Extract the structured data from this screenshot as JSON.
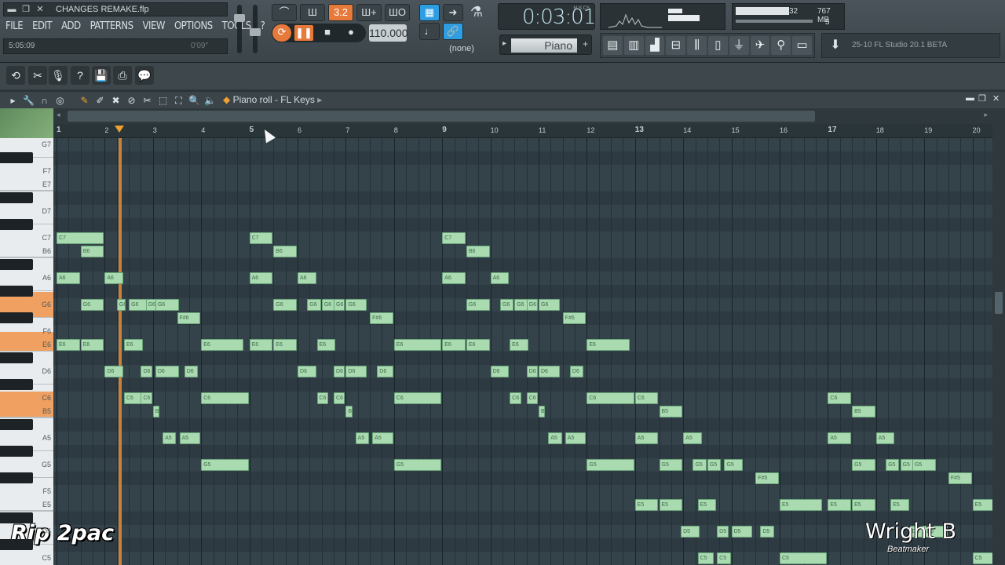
{
  "app": {
    "file_title": "CHANGES REMAKE.flp",
    "menu": [
      "FILE",
      "EDIT",
      "ADD",
      "PATTERNS",
      "VIEW",
      "OPTIONS",
      "TOOLS",
      "?"
    ],
    "hint_time": "5:05:09",
    "hint_right": "0'09\""
  },
  "transport": {
    "time": "0:03:01",
    "time_label": "M:S:CS",
    "tempo": "110.000",
    "pattern": "(none)",
    "beat_label": "3.2",
    "cpu": "32",
    "memory": "767 MB",
    "voices": "5"
  },
  "channel": {
    "name": "Piano"
  },
  "news": {
    "text": "25-10  FL Studio 20.1 BETA"
  },
  "piano_roll": {
    "title": "Piano roll - FL Keys",
    "bars": [
      "1",
      "2",
      "3",
      "4",
      "5",
      "6",
      "7",
      "8",
      "9",
      "10",
      "11",
      "12",
      "13",
      "14",
      "15",
      "16",
      "17",
      "18",
      "19",
      "20"
    ],
    "key_labels": [
      "G7",
      "F7",
      "E7",
      "D7",
      "C7",
      "B6",
      "A6",
      "G6",
      "F6",
      "E6",
      "D6",
      "C6",
      "B5",
      "A5",
      "G5",
      "F5",
      "E5",
      "D5",
      "C5"
    ],
    "notes": [
      {
        "p": "C7",
        "b": 0,
        "w": 1
      },
      {
        "p": "B6",
        "b": 0.5,
        "w": 0.5
      },
      {
        "p": "A6",
        "b": 0,
        "w": 0.5
      },
      {
        "p": "A6",
        "b": 1,
        "w": 0.4
      },
      {
        "p": "G6",
        "b": 0.5,
        "w": 0.5
      },
      {
        "p": "G6",
        "b": 1.25,
        "w": 0.2
      },
      {
        "p": "G6",
        "b": 1.5,
        "w": 0.4
      },
      {
        "p": "G6",
        "b": 1.85,
        "w": 0.25
      },
      {
        "p": "G6",
        "b": 2.05,
        "w": 0.5
      },
      {
        "p": "F#6",
        "b": 2.5,
        "w": 0.5
      },
      {
        "p": "E6",
        "b": 0,
        "w": 0.5
      },
      {
        "p": "E6",
        "b": 0.5,
        "w": 0.5
      },
      {
        "p": "E6",
        "b": 1.4,
        "w": 0.4
      },
      {
        "p": "E6",
        "b": 3,
        "w": 0.9
      },
      {
        "p": "D6",
        "b": 1,
        "w": 0.4
      },
      {
        "p": "D6",
        "b": 1.75,
        "w": 0.25
      },
      {
        "p": "D6",
        "b": 2.05,
        "w": 0.5
      },
      {
        "p": "D6",
        "b": 2.65,
        "w": 0.3
      },
      {
        "p": "C6",
        "b": 1.4,
        "w": 0.4
      },
      {
        "p": "C6",
        "b": 1.75,
        "w": 0.25
      },
      {
        "p": "C6",
        "b": 3,
        "w": 1
      },
      {
        "p": "B5",
        "b": 2,
        "w": 0.15
      },
      {
        "p": "A5",
        "b": 2.2,
        "w": 0.3
      },
      {
        "p": "A5",
        "b": 2.55,
        "w": 0.45
      },
      {
        "p": "G5",
        "b": 3,
        "w": 1
      },
      {
        "p": "C7",
        "b": 4,
        "w": 0.5
      },
      {
        "p": "B6",
        "b": 4.5,
        "w": 0.5
      },
      {
        "p": "A6",
        "b": 4,
        "w": 0.5
      },
      {
        "p": "A6",
        "b": 5,
        "w": 0.4
      },
      {
        "p": "G6",
        "b": 4.5,
        "w": 0.5
      },
      {
        "p": "G6",
        "b": 5.2,
        "w": 0.3
      },
      {
        "p": "G6",
        "b": 5.5,
        "w": 0.3
      },
      {
        "p": "G6",
        "b": 5.75,
        "w": 0.25
      },
      {
        "p": "G6",
        "b": 6,
        "w": 0.45
      },
      {
        "p": "F#6",
        "b": 6.5,
        "w": 0.5
      },
      {
        "p": "E6",
        "b": 4,
        "w": 0.5
      },
      {
        "p": "E6",
        "b": 4.5,
        "w": 0.5
      },
      {
        "p": "E6",
        "b": 5.4,
        "w": 0.4
      },
      {
        "p": "E6",
        "b": 7,
        "w": 1
      },
      {
        "p": "D6",
        "b": 5,
        "w": 0.4
      },
      {
        "p": "D6",
        "b": 5.75,
        "w": 0.25
      },
      {
        "p": "D6",
        "b": 6,
        "w": 0.45
      },
      {
        "p": "D6",
        "b": 6.65,
        "w": 0.35
      },
      {
        "p": "C6",
        "b": 5.4,
        "w": 0.25
      },
      {
        "p": "C6",
        "b": 5.75,
        "w": 0.25
      },
      {
        "p": "C6",
        "b": 7,
        "w": 1
      },
      {
        "p": "B5",
        "b": 6,
        "w": 0.15
      },
      {
        "p": "A5",
        "b": 6.2,
        "w": 0.3
      },
      {
        "p": "A5",
        "b": 6.55,
        "w": 0.45
      },
      {
        "p": "G5",
        "b": 7,
        "w": 1
      },
      {
        "p": "C7",
        "b": 8,
        "w": 0.5
      },
      {
        "p": "B6",
        "b": 8.5,
        "w": 0.5
      },
      {
        "p": "A6",
        "b": 8,
        "w": 0.5
      },
      {
        "p": "A6",
        "b": 9,
        "w": 0.4
      },
      {
        "p": "G6",
        "b": 8.5,
        "w": 0.5
      },
      {
        "p": "G6",
        "b": 9.2,
        "w": 0.3
      },
      {
        "p": "G6",
        "b": 9.5,
        "w": 0.3
      },
      {
        "p": "G6",
        "b": 9.75,
        "w": 0.25
      },
      {
        "p": "G6",
        "b": 10,
        "w": 0.45
      },
      {
        "p": "F#6",
        "b": 10.5,
        "w": 0.5
      },
      {
        "p": "E6",
        "b": 8,
        "w": 0.5
      },
      {
        "p": "E6",
        "b": 8.5,
        "w": 0.5
      },
      {
        "p": "E6",
        "b": 9.4,
        "w": 0.4
      },
      {
        "p": "E6",
        "b": 11,
        "w": 0.9
      },
      {
        "p": "D6",
        "b": 9,
        "w": 0.4
      },
      {
        "p": "D6",
        "b": 9.75,
        "w": 0.25
      },
      {
        "p": "D6",
        "b": 10,
        "w": 0.45
      },
      {
        "p": "D6",
        "b": 10.65,
        "w": 0.3
      },
      {
        "p": "C6",
        "b": 9.4,
        "w": 0.25
      },
      {
        "p": "C6",
        "b": 9.75,
        "w": 0.25
      },
      {
        "p": "C6",
        "b": 11,
        "w": 1
      },
      {
        "p": "C6",
        "b": 12,
        "w": 0.5
      },
      {
        "p": "B5",
        "b": 10,
        "w": 0.15
      },
      {
        "p": "A5",
        "b": 10.2,
        "w": 0.3
      },
      {
        "p": "A5",
        "b": 10.55,
        "w": 0.45
      },
      {
        "p": "A5",
        "b": 12,
        "w": 0.5
      },
      {
        "p": "A5",
        "b": 13,
        "w": 0.4
      },
      {
        "p": "B5",
        "b": 12.5,
        "w": 0.5
      },
      {
        "p": "G5",
        "b": 11,
        "w": 1
      },
      {
        "p": "G5",
        "b": 12.5,
        "w": 0.5
      },
      {
        "p": "G5",
        "b": 13.2,
        "w": 0.3
      },
      {
        "p": "G5",
        "b": 13.5,
        "w": 0.3
      },
      {
        "p": "G5",
        "b": 13.85,
        "w": 0.4
      },
      {
        "p": "F#5",
        "b": 14.5,
        "w": 0.5
      },
      {
        "p": "E5",
        "b": 12,
        "w": 0.5
      },
      {
        "p": "E5",
        "b": 12.5,
        "w": 0.5
      },
      {
        "p": "E5",
        "b": 13.3,
        "w": 0.4
      },
      {
        "p": "E5",
        "b": 15,
        "w": 0.9
      },
      {
        "p": "D5",
        "b": 12.95,
        "w": 0.4
      },
      {
        "p": "D5",
        "b": 13.7,
        "w": 0.25
      },
      {
        "p": "D5",
        "b": 14,
        "w": 0.45
      },
      {
        "p": "D5",
        "b": 14.6,
        "w": 0.3
      },
      {
        "p": "C5",
        "b": 13.3,
        "w": 0.35
      },
      {
        "p": "C5",
        "b": 13.7,
        "w": 0.3
      },
      {
        "p": "C5",
        "b": 15,
        "w": 1
      },
      {
        "p": "C6",
        "b": 16,
        "w": 0.5
      },
      {
        "p": "B5",
        "b": 16.5,
        "w": 0.5
      },
      {
        "p": "A5",
        "b": 16,
        "w": 0.5
      },
      {
        "p": "A5",
        "b": 17,
        "w": 0.4
      },
      {
        "p": "G5",
        "b": 16.5,
        "w": 0.5
      },
      {
        "p": "G5",
        "b": 17.2,
        "w": 0.3
      },
      {
        "p": "G5",
        "b": 17.5,
        "w": 0.3
      },
      {
        "p": "G5",
        "b": 17.75,
        "w": 0.5
      },
      {
        "p": "F#5",
        "b": 18.5,
        "w": 0.5
      },
      {
        "p": "E5",
        "b": 16,
        "w": 0.5
      },
      {
        "p": "E5",
        "b": 16.5,
        "w": 0.5
      },
      {
        "p": "E5",
        "b": 17.3,
        "w": 0.4
      },
      {
        "p": "E5",
        "b": 19,
        "w": 0.5
      },
      {
        "p": "D5",
        "b": 17.7,
        "w": 0.4
      },
      {
        "p": "D5",
        "b": 18,
        "w": 0.5
      },
      {
        "p": "C5",
        "b": 19,
        "w": 0.5
      }
    ]
  },
  "overlay": {
    "left": "Rip 2pac",
    "right": "Wright B",
    "right_sub": "Beatmaker"
  },
  "colors": {
    "note_fill": "#a9dab0",
    "note_border": "#6aa47a",
    "accent": "#e7793a",
    "playhead": "#e48d38"
  }
}
